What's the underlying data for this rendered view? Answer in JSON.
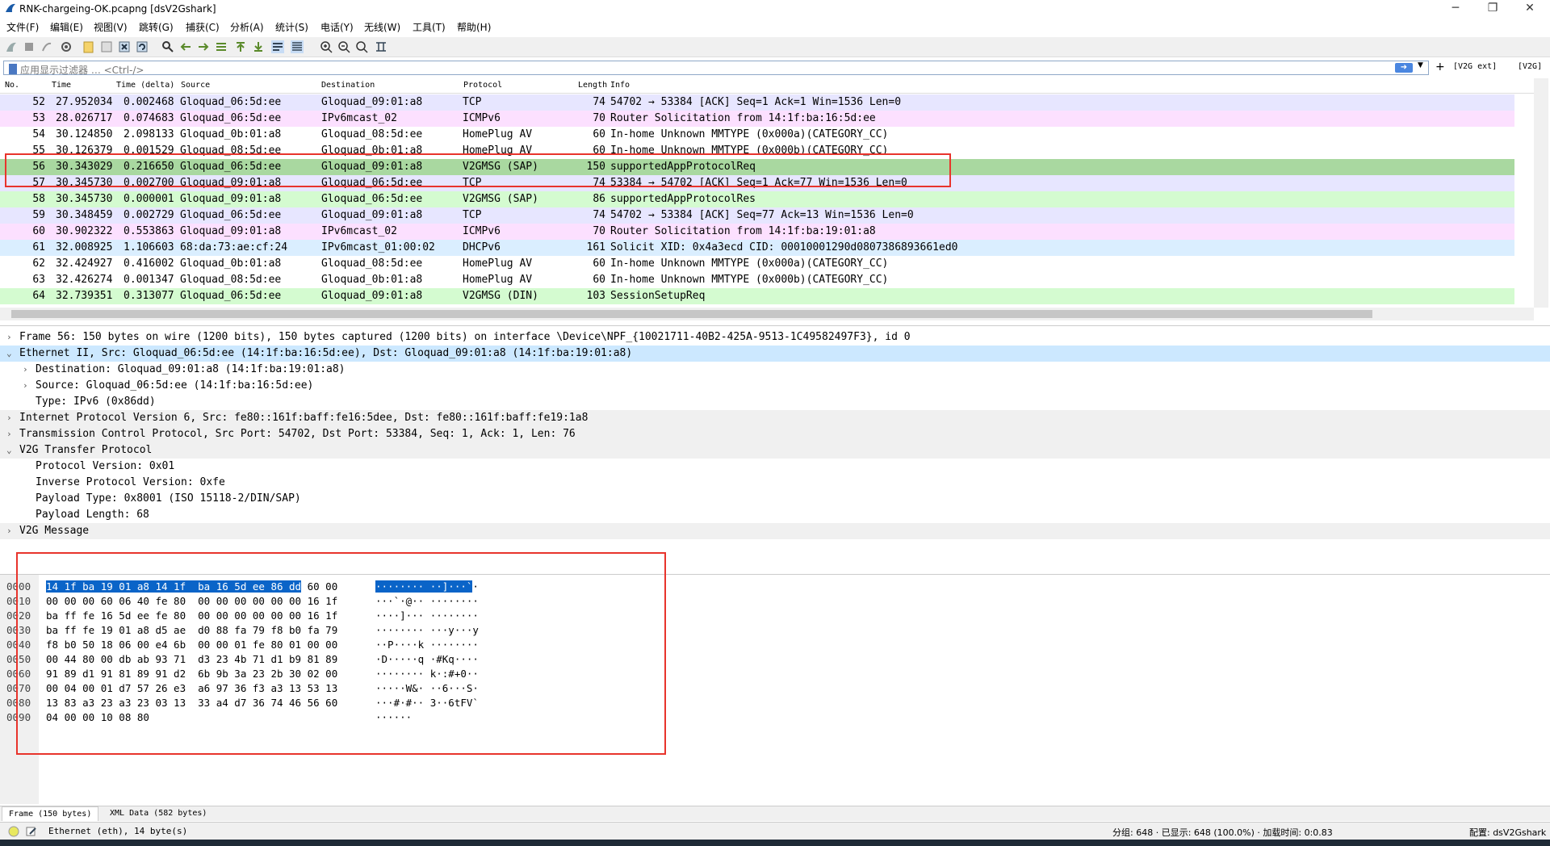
{
  "window": {
    "title": "RNK-chargeing-OK.pcapng [dsV2Gshark]",
    "controls": [
      "─",
      "❐",
      "✕"
    ]
  },
  "menu": [
    "文件(F)",
    "编辑(E)",
    "视图(V)",
    "跳转(G)",
    "捕获(C)",
    "分析(A)",
    "统计(S)",
    "电话(Y)",
    "无线(W)",
    "工具(T)",
    "帮助(H)"
  ],
  "filter": {
    "placeholder": "应用显示过滤器 … <Ctrl-/>",
    "apply_icon": "arrow-right-icon",
    "buttons": [
      "[V2G ext]",
      "[V2G]"
    ]
  },
  "packet_list": {
    "columns": [
      "No.",
      "Time",
      "Time (delta)",
      "Source",
      "Destination",
      "Protocol",
      "Length",
      "Info"
    ],
    "rows": [
      {
        "no": "52",
        "time": "27.952034",
        "delta": "0.002468",
        "src": "Gloquad_06:5d:ee",
        "dst": "Gloquad_09:01:a8",
        "proto": "TCP",
        "len": "74",
        "info": "54702 → 53384 [ACK] Seq=1 Ack=1 Win=1536 Len=0",
        "bg": "#e7e6ff"
      },
      {
        "no": "53",
        "time": "28.026717",
        "delta": "0.074683",
        "src": "Gloquad_06:5d:ee",
        "dst": "IPv6mcast_02",
        "proto": "ICMPv6",
        "len": "70",
        "info": "Router Solicitation from 14:1f:ba:16:5d:ee",
        "bg": "#fce0ff"
      },
      {
        "no": "54",
        "time": "30.124850",
        "delta": "2.098133",
        "src": "Gloquad_0b:01:a8",
        "dst": "Gloquad_08:5d:ee",
        "proto": "HomePlug AV",
        "len": "60",
        "info": "In-home Unknown MMTYPE (0x000a)(CATEGORY_CC)",
        "bg": "#ffffff"
      },
      {
        "no": "55",
        "time": "30.126379",
        "delta": "0.001529",
        "src": "Gloquad_08:5d:ee",
        "dst": "Gloquad_0b:01:a8",
        "proto": "HomePlug AV",
        "len": "60",
        "info": "In-home Unknown MMTYPE (0x000b)(CATEGORY_CC)",
        "bg": "#ffffff"
      },
      {
        "no": "56",
        "time": "30.343029",
        "delta": "0.216650",
        "src": "Gloquad_06:5d:ee",
        "dst": "Gloquad_09:01:a8",
        "proto": "V2GMSG (SAP)",
        "len": "150",
        "info": "supportedAppProtocolReq",
        "bg": "#a9d8a0"
      },
      {
        "no": "57",
        "time": "30.345730",
        "delta": "0.002700",
        "src": "Gloquad_09:01:a8",
        "dst": "Gloquad_06:5d:ee",
        "proto": "TCP",
        "len": "74",
        "info": "53384 → 54702 [ACK] Seq=1 Ack=77 Win=1536 Len=0",
        "bg": "#e7e6ff"
      },
      {
        "no": "58",
        "time": "30.345730",
        "delta": "0.000001",
        "src": "Gloquad_09:01:a8",
        "dst": "Gloquad_06:5d:ee",
        "proto": "V2GMSG (SAP)",
        "len": "86",
        "info": "supportedAppProtocolRes",
        "bg": "#d4fbd0"
      },
      {
        "no": "59",
        "time": "30.348459",
        "delta": "0.002729",
        "src": "Gloquad_06:5d:ee",
        "dst": "Gloquad_09:01:a8",
        "proto": "TCP",
        "len": "74",
        "info": "54702 → 53384 [ACK] Seq=77 Ack=13 Win=1536 Len=0",
        "bg": "#e7e6ff"
      },
      {
        "no": "60",
        "time": "30.902322",
        "delta": "0.553863",
        "src": "Gloquad_09:01:a8",
        "dst": "IPv6mcast_02",
        "proto": "ICMPv6",
        "len": "70",
        "info": "Router Solicitation from 14:1f:ba:19:01:a8",
        "bg": "#fce0ff"
      },
      {
        "no": "61",
        "time": "32.008925",
        "delta": "1.106603",
        "src": "68:da:73:ae:cf:24",
        "dst": "IPv6mcast_01:00:02",
        "proto": "DHCPv6",
        "len": "161",
        "info": "Solicit XID: 0x4a3ecd CID: 00010001290d0807386893661ed0",
        "bg": "#daeeff"
      },
      {
        "no": "62",
        "time": "32.424927",
        "delta": "0.416002",
        "src": "Gloquad_0b:01:a8",
        "dst": "Gloquad_08:5d:ee",
        "proto": "HomePlug AV",
        "len": "60",
        "info": "In-home Unknown MMTYPE (0x000a)(CATEGORY_CC)",
        "bg": "#ffffff"
      },
      {
        "no": "63",
        "time": "32.426274",
        "delta": "0.001347",
        "src": "Gloquad_08:5d:ee",
        "dst": "Gloquad_0b:01:a8",
        "proto": "HomePlug AV",
        "len": "60",
        "info": "In-home Unknown MMTYPE (0x000b)(CATEGORY_CC)",
        "bg": "#ffffff"
      },
      {
        "no": "64",
        "time": "32.739351",
        "delta": "0.313077",
        "src": "Gloquad_06:5d:ee",
        "dst": "Gloquad_09:01:a8",
        "proto": "V2GMSG (DIN)",
        "len": "103",
        "info": "SessionSetupReq",
        "bg": "#d4fbd0"
      }
    ]
  },
  "details": [
    {
      "indent": 0,
      "arrow": "›",
      "text": "Frame 56: 150 bytes on wire (1200 bits), 150 bytes captured (1200 bits) on interface \\Device\\NPF_{10021711-40B2-425A-9513-1C49582497F3}, id 0",
      "bg": "#ffffff"
    },
    {
      "indent": 0,
      "arrow": "⌄",
      "text": "Ethernet II, Src: Gloquad_06:5d:ee (14:1f:ba:16:5d:ee), Dst: Gloquad_09:01:a8 (14:1f:ba:19:01:a8)",
      "bg": "#cce8ff"
    },
    {
      "indent": 1,
      "arrow": "›",
      "text": "Destination: Gloquad_09:01:a8 (14:1f:ba:19:01:a8)",
      "bg": "#ffffff"
    },
    {
      "indent": 1,
      "arrow": "›",
      "text": "Source: Gloquad_06:5d:ee (14:1f:ba:16:5d:ee)",
      "bg": "#ffffff"
    },
    {
      "indent": 1,
      "arrow": "",
      "text": "Type: IPv6 (0x86dd)",
      "bg": "#ffffff"
    },
    {
      "indent": 0,
      "arrow": "›",
      "text": "Internet Protocol Version 6, Src: fe80::161f:baff:fe16:5dee, Dst: fe80::161f:baff:fe19:1a8",
      "bg": "#f0f0f0"
    },
    {
      "indent": 0,
      "arrow": "›",
      "text": "Transmission Control Protocol, Src Port: 54702, Dst Port: 53384, Seq: 1, Ack: 1, Len: 76",
      "bg": "#f0f0f0"
    },
    {
      "indent": 0,
      "arrow": "⌄",
      "text": "V2G Transfer Protocol",
      "bg": "#f0f0f0"
    },
    {
      "indent": 1,
      "arrow": "",
      "text": "Protocol Version: 0x01",
      "bg": "#ffffff"
    },
    {
      "indent": 1,
      "arrow": "",
      "text": "Inverse Protocol Version: 0xfe",
      "bg": "#ffffff"
    },
    {
      "indent": 1,
      "arrow": "",
      "text": "Payload Type: 0x8001 (ISO 15118-2/DIN/SAP)",
      "bg": "#ffffff"
    },
    {
      "indent": 1,
      "arrow": "",
      "text": "Payload Length: 68",
      "bg": "#ffffff"
    },
    {
      "indent": 0,
      "arrow": "›",
      "text": "V2G Message",
      "bg": "#f0f0f0"
    }
  ],
  "bytes": [
    {
      "off": "0000",
      "hex_sel": "14 1f ba 19 01 a8 14 1f  ba 16 5d ee 86 dd",
      "hex_rest": " 60 00",
      "asc_sel": "········ ··]···`",
      "asc_rest": "·"
    },
    {
      "off": "0010",
      "hex_sel": "",
      "hex_rest": "00 00 00 60 06 40 fe 80  00 00 00 00 00 00 16 1f",
      "asc_sel": "",
      "asc_rest": "···`·@·· ········"
    },
    {
      "off": "0020",
      "hex_sel": "",
      "hex_rest": "ba ff fe 16 5d ee fe 80  00 00 00 00 00 00 16 1f",
      "asc_sel": "",
      "asc_rest": "····]··· ········"
    },
    {
      "off": "0030",
      "hex_sel": "",
      "hex_rest": "ba ff fe 19 01 a8 d5 ae  d0 88 fa 79 f8 b0 fa 79",
      "asc_sel": "",
      "asc_rest": "········ ···y···y"
    },
    {
      "off": "0040",
      "hex_sel": "",
      "hex_rest": "f8 b0 50 18 06 00 e4 6b  00 00 01 fe 80 01 00 00",
      "asc_sel": "",
      "asc_rest": "··P····k ········"
    },
    {
      "off": "0050",
      "hex_sel": "",
      "hex_rest": "00 44 80 00 db ab 93 71  d3 23 4b 71 d1 b9 81 89",
      "asc_sel": "",
      "asc_rest": "·D·····q ·#Kq····"
    },
    {
      "off": "0060",
      "hex_sel": "",
      "hex_rest": "91 89 d1 91 81 89 91 d2  6b 9b 3a 23 2b 30 02 00",
      "asc_sel": "",
      "asc_rest": "········ k·:#+0··"
    },
    {
      "off": "0070",
      "hex_sel": "",
      "hex_rest": "00 04 00 01 d7 57 26 e3  a6 97 36 f3 a3 13 53 13",
      "asc_sel": "",
      "asc_rest": "·····W&· ··6···S·"
    },
    {
      "off": "0080",
      "hex_sel": "",
      "hex_rest": "13 83 a3 23 a3 23 03 13  33 a4 d7 36 74 46 56 60",
      "asc_sel": "",
      "asc_rest": "···#·#·· 3··6tFV`"
    },
    {
      "off": "0090",
      "hex_sel": "",
      "hex_rest": "04 00 00 10 08 80",
      "asc_sel": "",
      "asc_rest": "······"
    }
  ],
  "byte_tabs": [
    "Frame (150 bytes)",
    "XML Data (582 bytes)"
  ],
  "status": {
    "field": "Ethernet (eth), 14 byte(s)",
    "packets": "分组: 648 · 已显示: 648 (100.0%) · 加载时间: 0:0.83",
    "profile": "配置: dsV2Gshark"
  },
  "colors": {
    "selection": "#0a64c8",
    "annotation": "#e8342c"
  }
}
